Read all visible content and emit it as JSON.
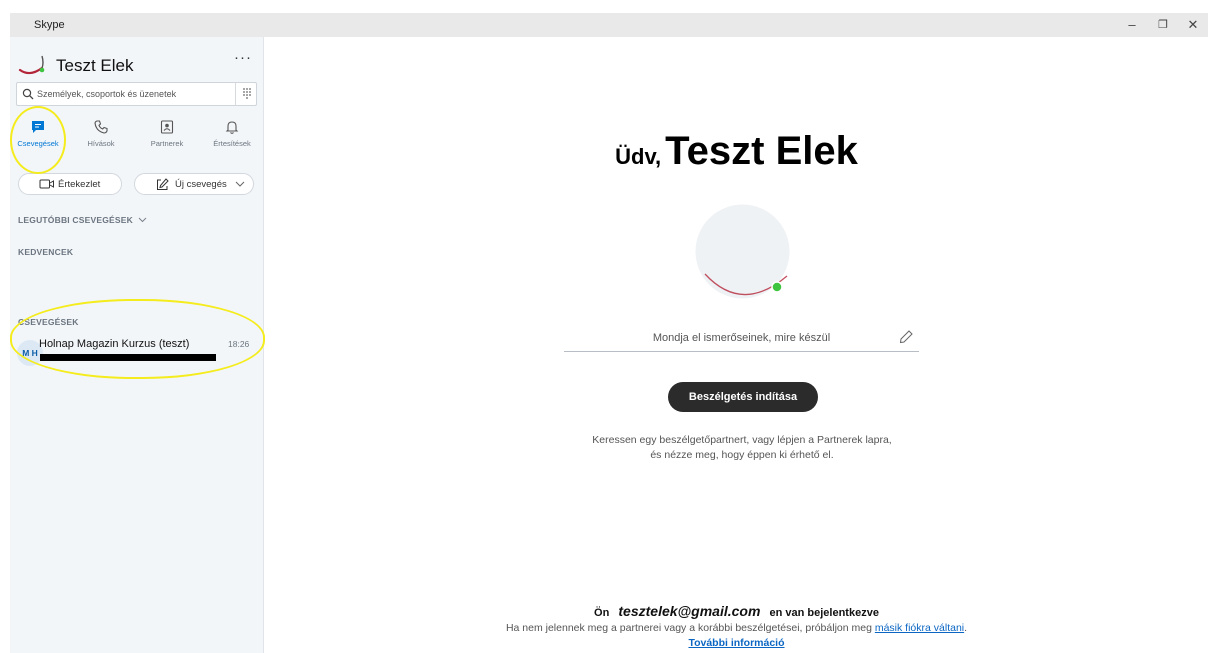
{
  "window": {
    "title": "Skype",
    "minimize": "–",
    "restore": "❐",
    "close": "✕"
  },
  "profile": {
    "name": "Teszt Elek",
    "more": "···"
  },
  "search": {
    "placeholder": "Személyek, csoportok és üzenetek"
  },
  "tabs": [
    {
      "label": "Csevegések",
      "icon": "chat-icon",
      "active": true
    },
    {
      "label": "Hívások",
      "icon": "phone-icon",
      "active": false
    },
    {
      "label": "Partnerek",
      "icon": "contacts-icon",
      "active": false
    },
    {
      "label": "Értesítések",
      "icon": "bell-icon",
      "active": false
    }
  ],
  "actions": {
    "meeting": "Értekezlet",
    "new_chat": "Új csevegés"
  },
  "sections": {
    "recent": "LEGUTÓBBI CSEVEGÉSEK",
    "favorites": "KEDVENCEK",
    "chats": "CSEVEGÉSEK"
  },
  "chats": [
    {
      "initials": "M H",
      "name": "Holnap Magazin Kurzus (teszt)",
      "time": "18:26"
    }
  ],
  "main": {
    "greeting_small": "Üdv,",
    "greeting_name": "Teszt Elek",
    "mood_placeholder": "Mondja el ismerőseinek, mire készül",
    "start_button": "Beszélgetés indítása",
    "hint": "Keressen egy beszélgetőpartnert, vagy lépjen a Partnerek lapra, és nézze meg, hogy éppen ki érhető el."
  },
  "footer": {
    "prefix": "Ön",
    "email": "tesztelek@gmail.com",
    "suffix": "en van bejelentkezve",
    "line2": "Ha nem jelennek meg a partnerei vagy a korábbi beszélgetései, próbáljon meg",
    "switch_link": "másik fiókra váltani",
    "more_info": "További információ"
  },
  "colors": {
    "accent": "#0078d4",
    "highlight": "#f4ec1c",
    "presence": "#3fc43f",
    "button": "#2b2b2b"
  }
}
